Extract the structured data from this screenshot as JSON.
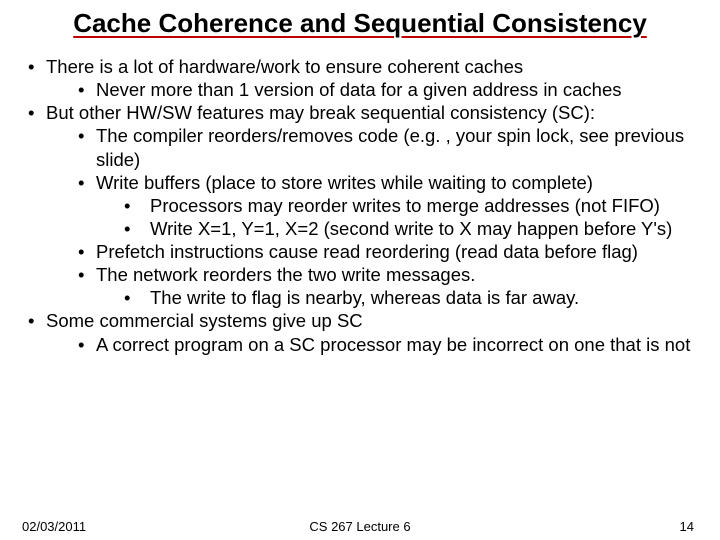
{
  "title": "Cache Coherence and Sequential Consistency",
  "b1": "There is a lot of hardware/work to ensure coherent caches",
  "b1a": "Never more than 1 version of data for a given address in caches",
  "b2": "But other HW/SW features may break sequential consistency (SC):",
  "b2a": "The compiler reorders/removes code (e.g. , your spin lock, see previous slide)",
  "b2b": "Write buffers (place to store writes while waiting to complete)",
  "b2b1": "Processors may reorder writes to merge addresses (not FIFO)",
  "b2b2": "Write X=1, Y=1, X=2 (second write to X may happen before Y's)",
  "b2c": "Prefetch instructions cause read reordering (read data before flag)",
  "b2d": "The network reorders the two write messages.",
  "b2d1": "The write to flag is nearby, whereas data is far away.",
  "b3": "Some commercial systems give up SC",
  "b3a": "A correct program on a SC processor may be incorrect on one that is not",
  "footer": {
    "date": "02/03/2011",
    "mid": "CS 267 Lecture 6",
    "page": "14"
  }
}
